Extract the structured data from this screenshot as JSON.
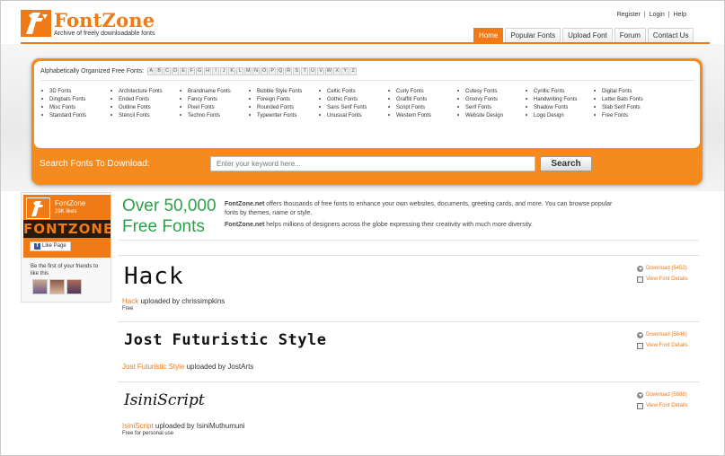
{
  "header": {
    "brand": "FontZone",
    "tagline": "Archive of freely downloadable fonts",
    "top_links": [
      "Register",
      "Login",
      "Help"
    ],
    "nav_tabs": [
      {
        "label": "Home",
        "active": true
      },
      {
        "label": "Popular Fonts",
        "active": false
      },
      {
        "label": "Upload Font",
        "active": false
      },
      {
        "label": "Forum",
        "active": false
      },
      {
        "label": "Contact Us",
        "active": false
      }
    ]
  },
  "alpha": {
    "label": "Alphabetically Organized Free Fonts:",
    "letters": [
      "A",
      "B",
      "C",
      "D",
      "E",
      "F",
      "G",
      "H",
      "I",
      "J",
      "K",
      "L",
      "M",
      "N",
      "O",
      "P",
      "Q",
      "R",
      "S",
      "T",
      "U",
      "V",
      "W",
      "X",
      "Y",
      "Z"
    ]
  },
  "categories": [
    [
      "3D Fonts",
      "Dingbats Fonts",
      "Misc Fonts",
      "Standard Fonts"
    ],
    [
      "Architecture Fonts",
      "Ended Fonts",
      "Outline Fonts",
      "Stencil Fonts"
    ],
    [
      "Brandname Fonts",
      "Fancy Fonts",
      "Pixel Fonts",
      "Techno Fonts"
    ],
    [
      "Bubble Style Fonts",
      "Foreign Fonts",
      "Rounded Fonts",
      "Typewriter Fonts"
    ],
    [
      "Celtic Fonts",
      "Gothic Fonts",
      "Sans Serif Fonts",
      "Unusual Fonts"
    ],
    [
      "Curly Fonts",
      "Graffiti Fonts",
      "Script Fonts",
      "Western Fonts"
    ],
    [
      "Cutesy Fonts",
      "Groovy Fonts",
      "Serif Fonts",
      "Website Design"
    ],
    [
      "Cyrillic Fonts",
      "Handwriting Fonts",
      "Shadow Fonts",
      "Logo Design"
    ],
    [
      "Digital Fonts",
      "Letter Bats Fonts",
      "Slab Serif Fonts",
      "Free Fonts"
    ]
  ],
  "search": {
    "label": "Search Fonts To Download:",
    "placeholder": "Enter your keyword here...",
    "button": "Search"
  },
  "sidebar": {
    "page_name": "FontZone",
    "likes": "29K likes",
    "banner_text": "FONTZONE",
    "like_button": "Like Page",
    "friends_text": "Be the first of your friends to like this"
  },
  "hero": {
    "title_line1": "Over 50,000",
    "title_line2": "Free Fonts",
    "p1_brand": "FontZone.net",
    "p1_text": " offers thousands of free fonts to enhance your own websites, documents, greeting cards, and more. You can browse popular fonts by themes, name or style.",
    "p2_brand": "FontZone.net",
    "p2_text": " helps millions of designers across the globe expressing their creativity with much more diversity."
  },
  "fonts": [
    {
      "sample": "Hack",
      "name": "Hack",
      "uploaded_by_text": " uploaded by chrissimpkins",
      "license": "Free",
      "download": "Download (5453)",
      "view": "View Font Details"
    },
    {
      "sample": "Jost Futuristic Style",
      "name": "Jost Futuristic Style",
      "uploaded_by_text": " uploaded by JostArts",
      "license": "",
      "download": "Download (5846)",
      "view": "View Font Details"
    },
    {
      "sample": "IsiniScript",
      "name": "IsiniScript",
      "uploaded_by_text": " uploaded by IsiniMuthumuni",
      "license": "Free for personal use",
      "download": "Download (5888)",
      "view": "View Font Details"
    }
  ],
  "colors": {
    "accent": "#f07a16",
    "green": "#2ea04a",
    "fb_blue": "#3b5998"
  }
}
